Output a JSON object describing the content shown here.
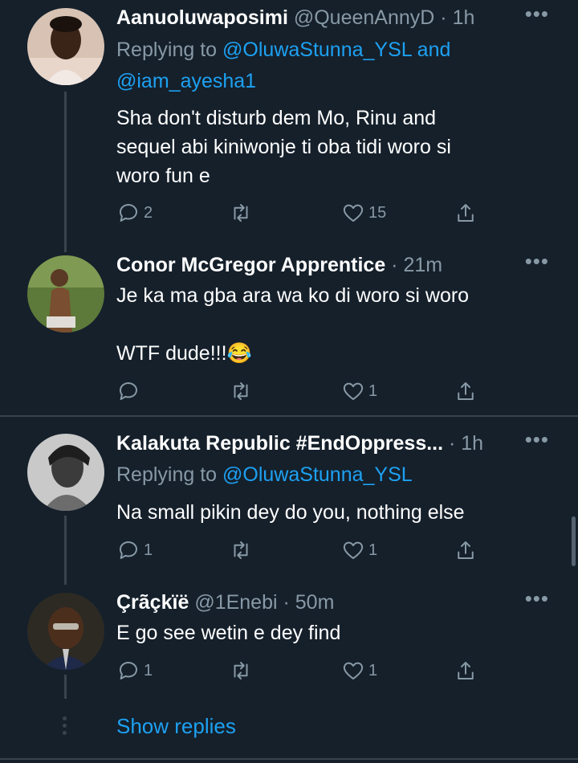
{
  "tweets": [
    {
      "name": "Aanuoluwaposimi",
      "handle": "@QueenAnnyD",
      "sep": " · ",
      "time": "1h",
      "reply_prefix": "Replying to ",
      "reply_line1_link": "@OluwaStunna_YSL and",
      "reply_line2_link": "@iam_ayesha1",
      "text_lines": [
        "Sha don't disturb dem Mo, Rinu and",
        "sequel abi kiniwonje ti oba tidi woro si",
        "woro fun e"
      ],
      "reply_count": "2",
      "retweet_count": "",
      "like_count": "15"
    },
    {
      "name": "Conor McGregor Apprentice",
      "sep": " · ",
      "time": "21m",
      "text_line1": "Je ka ma gba ara wa ko di woro si woro",
      "text_line2": "WTF dude!!!😂",
      "reply_count": "",
      "retweet_count": "",
      "like_count": "1"
    },
    {
      "name": "Kalakuta Republic #EndOppress...",
      "sep": " · ",
      "time": "1h",
      "reply_prefix": "Replying to ",
      "reply_link": "@OluwaStunna_YSL",
      "text": "Na small pikin dey do you, nothing else",
      "reply_count": "1",
      "retweet_count": "",
      "like_count": "1"
    },
    {
      "name": "Çrãçkïë",
      "handle": "@1Enebi",
      "sep": " · ",
      "time": "50m",
      "text": "E go see wetin e dey find",
      "reply_count": "1",
      "retweet_count": "",
      "like_count": "1"
    }
  ],
  "show_replies_label": "Show replies",
  "more_glyph": "•••",
  "icons": {
    "reply": "reply-icon",
    "retweet": "retweet-icon",
    "like": "heart-icon",
    "share": "share-icon",
    "more": "more-icon"
  },
  "colors": {
    "background": "#15202b",
    "text": "#ffffff",
    "secondary": "#8899a6",
    "link": "#1da1f2",
    "divider": "#38444d"
  }
}
